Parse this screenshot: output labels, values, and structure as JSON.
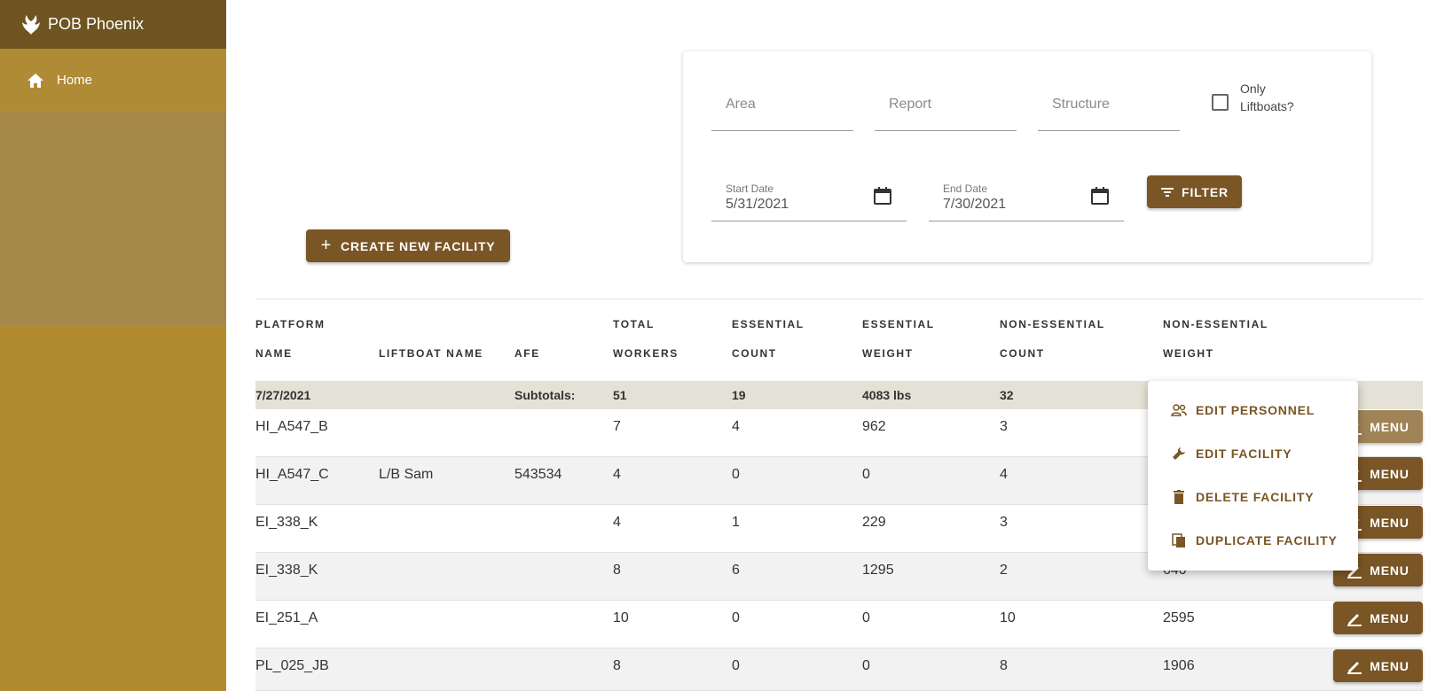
{
  "app": {
    "title": "POB Phoenix"
  },
  "sidebar": {
    "items": [
      {
        "label": "Home",
        "icon": "home-icon"
      }
    ]
  },
  "actions": {
    "create_label": "CREATE NEW FACILITY"
  },
  "filters": {
    "area_placeholder": "Area",
    "report_placeholder": "Report",
    "structure_placeholder": "Structure",
    "liftboats_label": "Only Liftboats?",
    "start_date_label": "Start Date",
    "start_date_value": "5/31/2021",
    "end_date_label": "End Date",
    "end_date_value": "7/30/2021",
    "filter_label": "FILTER"
  },
  "table": {
    "headers": [
      [
        "PLATFORM",
        "NAME"
      ],
      [
        "",
        "LIFTBOAT NAME"
      ],
      [
        "",
        "AFE"
      ],
      [
        "TOTAL",
        "WORKERS"
      ],
      [
        "ESSENTIAL",
        "COUNT"
      ],
      [
        "ESSENTIAL",
        "WEIGHT"
      ],
      [
        "NON-ESSENTIAL",
        "COUNT"
      ],
      [
        "NON-ESSENTIAL",
        "WEIGHT"
      ]
    ],
    "subtotal": {
      "date": "7/27/2021",
      "label": "Subtotals:",
      "total_workers": "51",
      "essential_count": "19",
      "essential_weight": "4083 lbs",
      "non_essential_count": "32"
    },
    "rows": [
      {
        "platform": "HI_A547_B",
        "liftboat": "",
        "afe": "",
        "total": "7",
        "ess_count": "4",
        "ess_weight": "962",
        "non_count": "3",
        "non_weight": ""
      },
      {
        "platform": "HI_A547_C",
        "liftboat": "L/B Sam",
        "afe": "543534",
        "total": "4",
        "ess_count": "0",
        "ess_weight": "0",
        "non_count": "4",
        "non_weight": ""
      },
      {
        "platform": "EI_338_K",
        "liftboat": "",
        "afe": "",
        "total": "4",
        "ess_count": "1",
        "ess_weight": "229",
        "non_count": "3",
        "non_weight": ""
      },
      {
        "platform": "EI_338_K",
        "liftboat": "",
        "afe": "",
        "total": "8",
        "ess_count": "6",
        "ess_weight": "1295",
        "non_count": "2",
        "non_weight": "640"
      },
      {
        "platform": "EI_251_A",
        "liftboat": "",
        "afe": "",
        "total": "10",
        "ess_count": "0",
        "ess_weight": "0",
        "non_count": "10",
        "non_weight": "2595"
      },
      {
        "platform": "PL_025_JB",
        "liftboat": "",
        "afe": "",
        "total": "8",
        "ess_count": "0",
        "ess_weight": "0",
        "non_count": "8",
        "non_weight": "1906"
      }
    ],
    "menu_label": "MENU"
  },
  "context_menu": {
    "items": [
      {
        "label": "EDIT PERSONNEL",
        "icon": "people-icon"
      },
      {
        "label": "EDIT FACILITY",
        "icon": "wrench-icon"
      },
      {
        "label": "DELETE FACILITY",
        "icon": "trash-icon"
      },
      {
        "label": "DUPLICATE FACILITY",
        "icon": "copy-icon"
      }
    ]
  },
  "colors": {
    "sidebar": "#b28a30",
    "brand_bar": "#6e5420",
    "primary": "#7a5525",
    "subtotal_bg": "#e4e1d6"
  }
}
